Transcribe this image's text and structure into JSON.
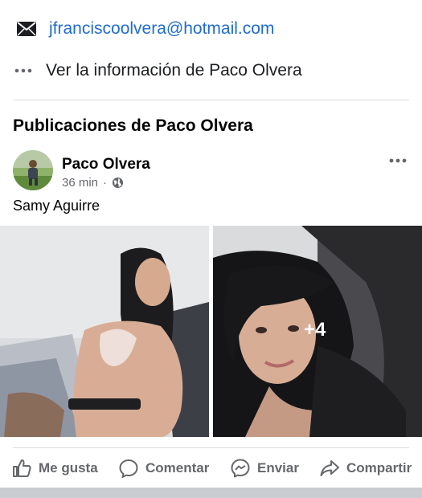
{
  "contact": {
    "email": "jfranciscoolvera@hotmail.com",
    "info_link": "Ver la información de Paco Olvera"
  },
  "section": {
    "title": "Publicaciones de Paco Olvera"
  },
  "post": {
    "author": "Paco Olvera",
    "time": "36 min",
    "separator": "·",
    "text": "Samy Aguirre",
    "extra_photos": "+4"
  },
  "actions": {
    "like": "Me gusta",
    "comment": "Comentar",
    "send": "Enviar",
    "share": "Compartir"
  },
  "icons": {
    "email": "envelope-icon",
    "info": "more-dots-icon",
    "privacy": "globe-icon",
    "options": "more-horizontal-icon",
    "like": "thumbs-up-icon",
    "comment": "speech-bubble-icon",
    "send": "messenger-icon",
    "share": "share-arrow-icon"
  },
  "colors": {
    "link": "#1f6bd1",
    "secondary": "#65676b",
    "divider": "#dadde1"
  }
}
